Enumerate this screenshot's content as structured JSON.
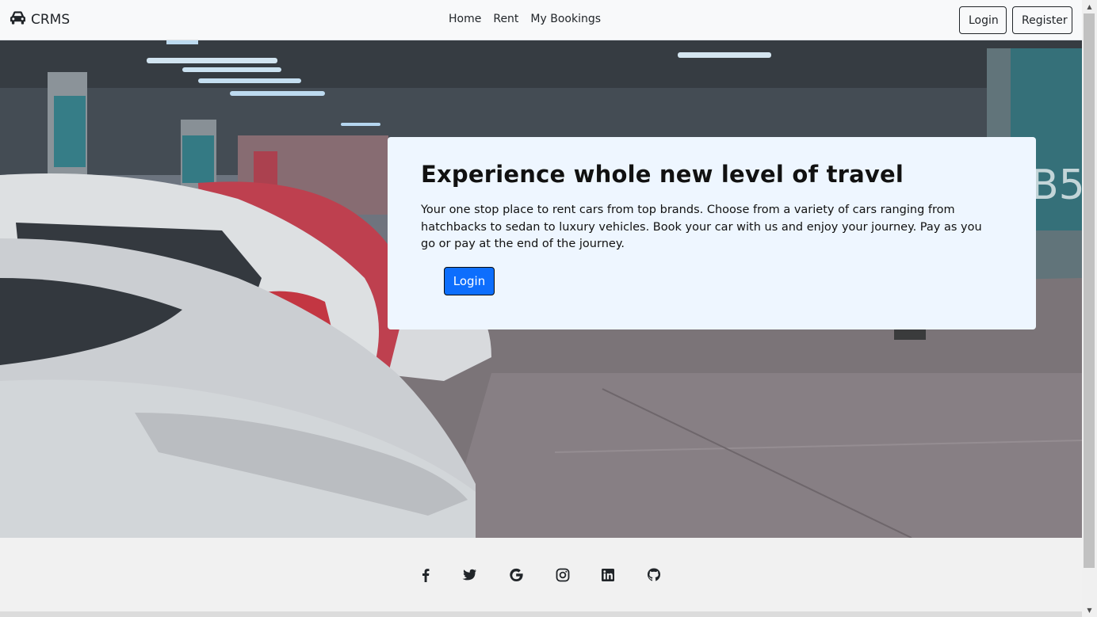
{
  "navbar": {
    "brand_icon": "car-icon",
    "brand": "CRMS",
    "links": [
      "Home",
      "Rent",
      "My Bookings"
    ],
    "login_label": "Login",
    "register_label": "Register"
  },
  "hero": {
    "background": "parking-garage-photo",
    "title": "Experience whole new level of travel",
    "description": "Your one stop place to rent cars from top brands. Choose from a variety of cars ranging from hatchbacks to sedan to luxury vehicles. Book your car with us and enjoy your journey. Pay as you go or pay at the end of the journey.",
    "button_label": "Login",
    "accent": "#0d6efd",
    "card_bg": "#eef6ff"
  },
  "footer": {
    "icons": [
      "facebook-icon",
      "twitter-icon",
      "google-icon",
      "instagram-icon",
      "linkedin-icon",
      "github-icon"
    ]
  }
}
